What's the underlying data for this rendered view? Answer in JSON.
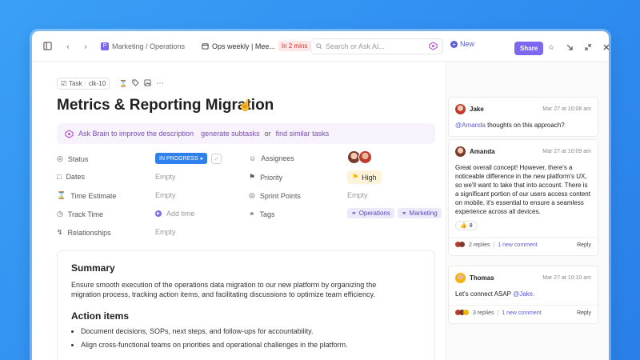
{
  "topbar": {
    "breadcrumb": "Marketing / Operations",
    "space_badge": "P",
    "meeting_title": "Ops weekly | Mee...",
    "meeting_badge": "In 2 mins",
    "search_placeholder": "Search or Ask AI...",
    "new_label": "New",
    "share_label": "Share"
  },
  "task": {
    "type_label": "Task",
    "id": "clk-10",
    "title": "Metrics & Reporting Migration"
  },
  "brain": {
    "ask": "Ask Brain to improve the description",
    "generate": "generate subtasks",
    "or": "or",
    "similar": "find similar tasks"
  },
  "props": {
    "status_label": "Status",
    "status_value": "IN PROGRESS",
    "dates_label": "Dates",
    "dates_value": "Empty",
    "estimate_label": "Time Estimate",
    "estimate_value": "Empty",
    "track_label": "Track Time",
    "track_value": "Add time",
    "relationships_label": "Relationships",
    "relationships_value": "Empty",
    "assignees_label": "Assignees",
    "priority_label": "Priority",
    "priority_value": "High",
    "sprint_label": "Sprint Points",
    "sprint_value": "Empty",
    "tags_label": "Tags",
    "tags": [
      "Operations",
      "Marketing"
    ]
  },
  "summary": {
    "heading": "Summary",
    "body": "Ensure smooth execution of the operations data migration to our new platform by organizing the migration process, tracking action items, and facilitating discussions to optimize team efficiency.",
    "actions_heading": "Action items",
    "actions": [
      "Document decisions, SOPs, next steps, and follow-ups for accountability.",
      "Align cross-functional teams on priorities and operational challenges in the platform."
    ]
  },
  "comments": [
    {
      "author": "Jake",
      "time": "Mar 27 at 10:08 am",
      "mention": "@Amanda",
      "text": " thoughts on this approach?"
    },
    {
      "author": "Amanda",
      "time": "Mar 27 at 10:09 am",
      "text": "Great overall concept! However, there's a noticeable difference in the new platform's UX, so we'll want to take that into account. There is a significant portion of our users access content on mobile, it's essential to ensure a seamless experience across all devices.",
      "reaction_count": "8",
      "replies": "2 replies",
      "new_comment": "1 new comment",
      "reply": "Reply"
    },
    {
      "author": "Thomas",
      "time": "Mar 27 at 10:10 am",
      "text": "Let's connect ASAP ",
      "mention": "@Jake.",
      "replies": "3 replies",
      "new_comment": "1 new comment",
      "reply": "Reply"
    }
  ],
  "colors": {
    "accent": "#7b68ee",
    "status": "#2f80ed",
    "background": "#2f8df0"
  }
}
